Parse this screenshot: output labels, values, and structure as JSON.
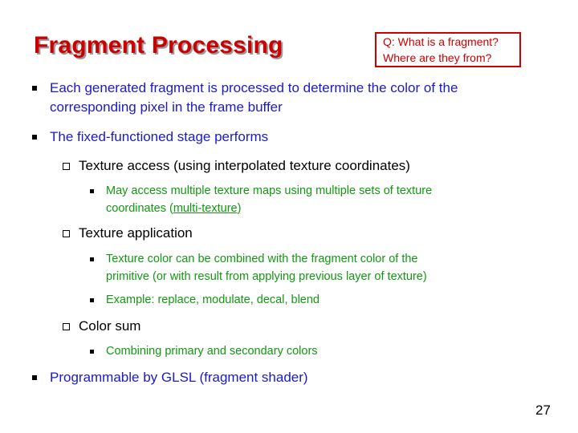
{
  "slide": {
    "title": "Fragment Processing",
    "question_box": {
      "line1": "Q: What is a fragment?",
      "line2": "Where are they from?"
    },
    "bullets": {
      "b1_line1": "Each generated fragment is processed to determine the color of the",
      "b1_line2": "corresponding pixel in the frame buffer",
      "b2": "The fixed-functioned stage performs",
      "b2_sub1": "Texture access (using interpolated texture coordinates)",
      "b2_sub1_detail_line1": "May access multiple texture maps using multiple sets of texture",
      "b2_sub1_detail_line2_pre": "coordinates (",
      "b2_sub1_detail_link": "multi-texture",
      "b2_sub1_detail_line2_post": ")",
      "b2_sub2": "Texture application",
      "b2_sub2_detail1_line1": "Texture color can be combined with the fragment color of the",
      "b2_sub2_detail1_line2": "primitive (or with result from applying previous layer of texture)",
      "b2_sub2_detail2": "Example: replace, modulate, decal, blend",
      "b2_sub3": "Color sum",
      "b2_sub3_detail": "Combining primary and secondary colors",
      "b3": "Programmable by GLSL (fragment shader)"
    },
    "page_number": "27",
    "colors": {
      "title": "#cc0000",
      "level1": "#1a1acc",
      "level3": "#119911"
    }
  }
}
